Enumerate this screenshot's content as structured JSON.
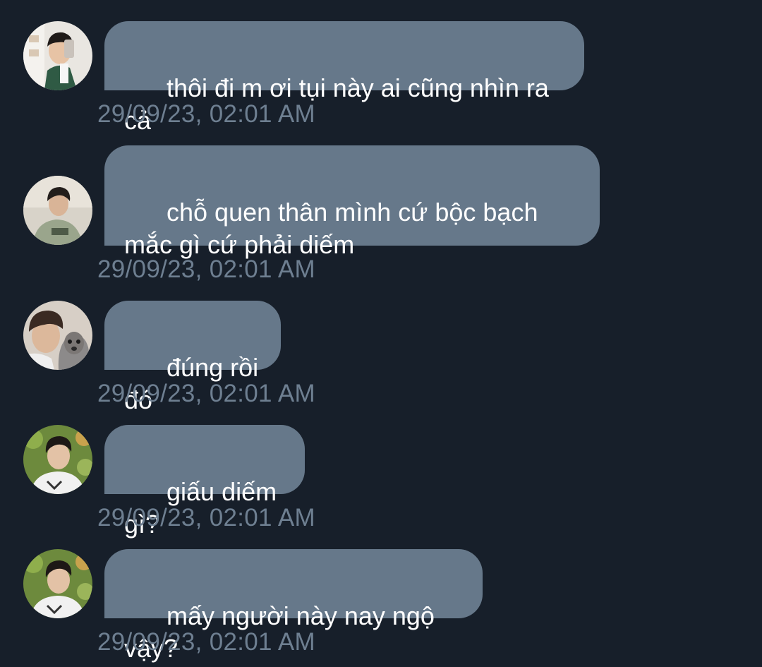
{
  "messages": [
    {
      "text": "thôi đi m ơi tụi này ai cũng nhìn ra cả",
      "time": "29/09/23, 02:01 AM",
      "avatar": "avatar-photo-selfie-mirror"
    },
    {
      "text": "chỗ quen thân mình cứ bộc bạch mắc gì cứ phải diếm",
      "time": "29/09/23, 02:01 AM",
      "avatar": "avatar-photo-green-hoodie"
    },
    {
      "text": "đúng rồi đó",
      "time": "29/09/23, 02:01 AM",
      "avatar": "avatar-photo-with-dog"
    },
    {
      "text": "giấu diếm gì?",
      "time": "29/09/23, 02:01 AM",
      "avatar": "avatar-photo-smiling-plants"
    },
    {
      "text": "mấy người này nay ngộ vậy?",
      "time": "29/09/23, 02:01 AM",
      "avatar": "avatar-photo-smiling-plants"
    }
  ],
  "colors": {
    "background": "#171f2a",
    "bubble": "#66788a",
    "bubble_text": "#ffffff",
    "timestamp": "#6e7f91"
  }
}
